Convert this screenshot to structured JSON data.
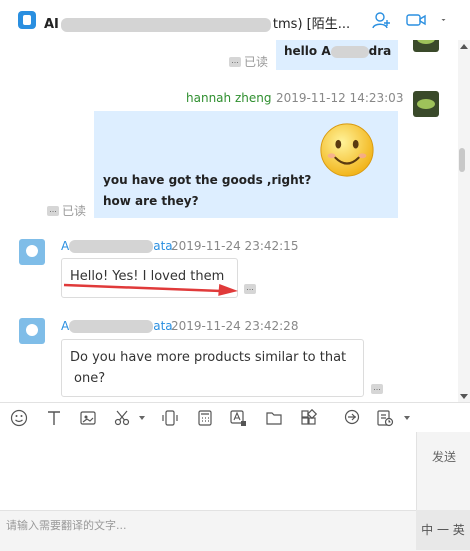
{
  "header": {
    "title_prefix": "AI",
    "title_suffix": "tms)",
    "stranger_label": "[陌生...",
    "icons": [
      "add-contact-icon",
      "video-call-icon",
      "chevron-down-icon"
    ]
  },
  "messages": [
    {
      "direction": "out",
      "text": "hello A",
      "text_suffix": "dra",
      "read_label": "已读"
    },
    {
      "direction": "out",
      "sender": "hannah zheng",
      "timestamp": "2019-11-12 14:23:03",
      "lines": [
        "you have got the goods ,right?",
        "how are they?"
      ],
      "read_label": "已读",
      "emoji": "smiley-face-icon"
    },
    {
      "direction": "in",
      "sender_prefix": "A",
      "sender_suffix": "ata",
      "timestamp": "2019-11-24 23:42:15",
      "text": "Hello! Yes! I loved them"
    },
    {
      "direction": "in",
      "sender_prefix": "A",
      "sender_suffix": "ata",
      "timestamp": "2019-11-24 23:42:28",
      "lines": [
        "Do you have more products similar to that",
        "one?"
      ]
    }
  ],
  "toolbar": {
    "icons": [
      "emoji-icon",
      "text-format-icon",
      "screenshot-icon",
      "scissors-icon",
      "shake-icon",
      "calculator-icon",
      "image-text-icon",
      "folder-icon",
      "apps-icon",
      "quick-reply-icon",
      "history-icon"
    ]
  },
  "compose": {
    "send_label": "发送",
    "translate_placeholder": "请输入需要翻译的文字...",
    "lang_label": "中 一 英"
  },
  "colors": {
    "accent": "#2a8fe0",
    "bubble_out": "#ddeeff",
    "sender_out": "#2f8f2f",
    "sender_in": "#2a8fe0",
    "arrow": "#e03a3a"
  }
}
